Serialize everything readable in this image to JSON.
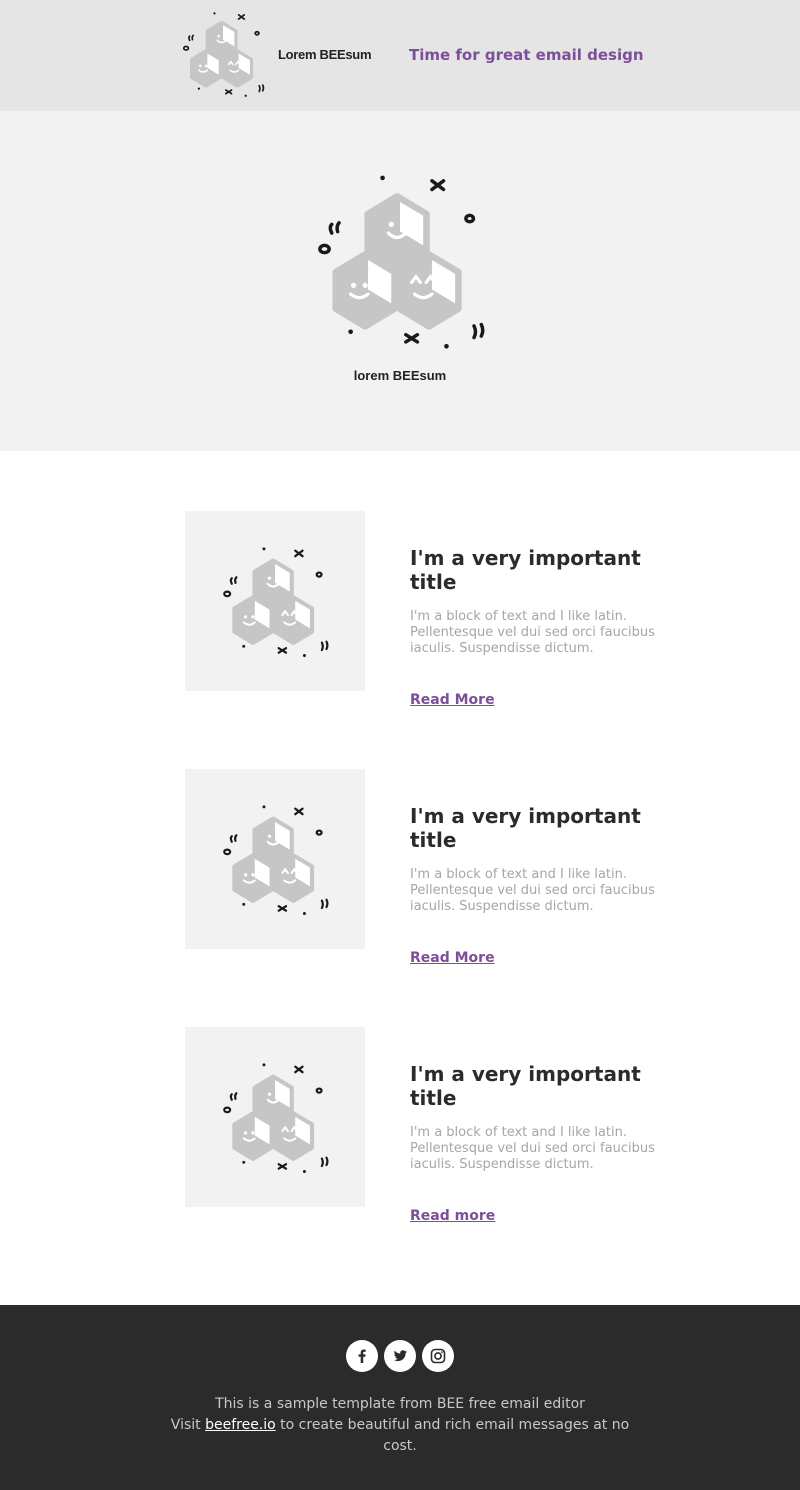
{
  "header": {
    "brand": "Lorem BEEsum",
    "tagline": "Time for great email design"
  },
  "hero": {
    "brand": "lorem BEEsum"
  },
  "articles": [
    {
      "title": "I'm a very important title",
      "text": "I'm a block of text and I like latin. Pellentesque vel dui sed orci faucibus iaculis. Suspendisse dictum.",
      "link": "Read More"
    },
    {
      "title": "I'm a very important title",
      "text": "I'm a block of text and I like latin. Pellentesque vel dui sed orci faucibus iaculis. Suspendisse dictum.",
      "link": "Read More"
    },
    {
      "title": "I'm a very important title",
      "text": "I'm a block of text and I like latin. Pellentesque vel dui sed orci faucibus iaculis. Suspendisse dictum.",
      "link": "Read more"
    }
  ],
  "footer": {
    "social_icons": [
      "facebook-icon",
      "twitter-icon",
      "instagram-icon"
    ],
    "line1": "This is a sample template from BEE free email editor",
    "line2_prefix": "Visit",
    "link": "beefree.io",
    "line2_suffix": "to create beautiful and rich email messages at no cost."
  },
  "colors": {
    "accent": "#7d4e99",
    "header_bg": "#e5e5e5",
    "hero_bg": "#f2f2f2",
    "footer_bg": "#2b2b2b",
    "title": "#2b2b2b",
    "body_text": "#a6a6a6"
  }
}
